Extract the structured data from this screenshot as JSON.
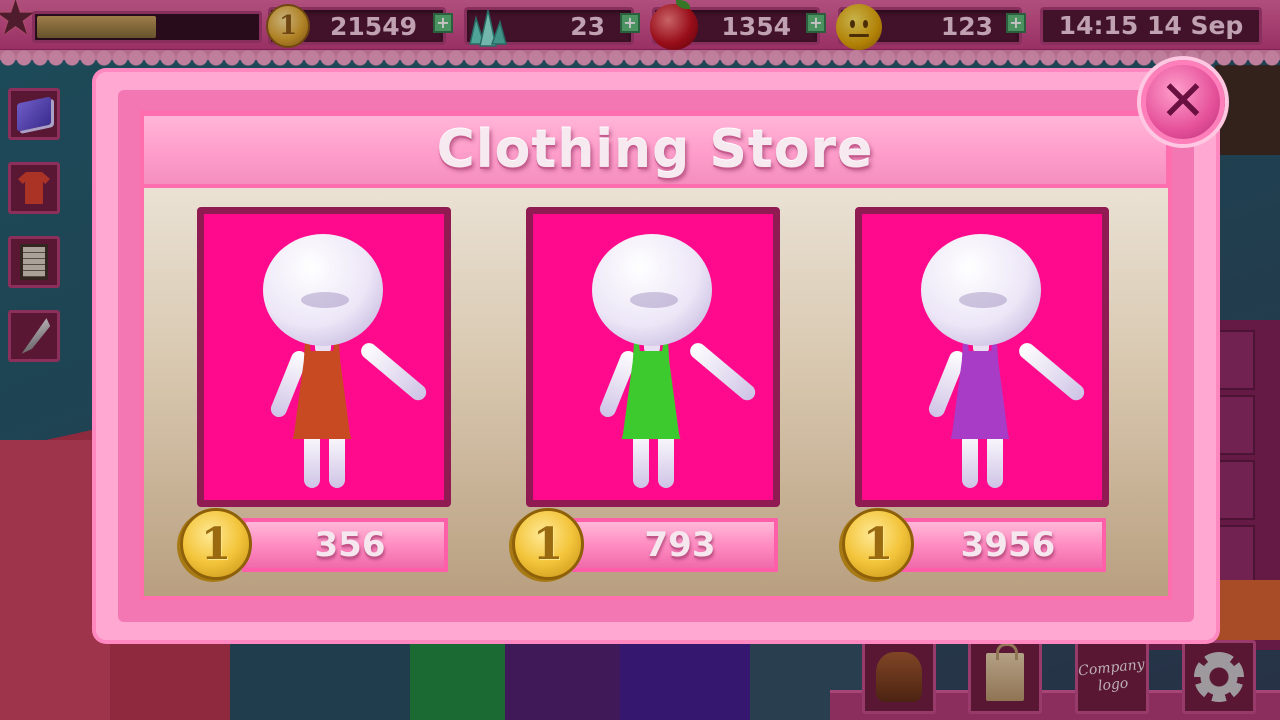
{
  "hud": {
    "xp_fill": 0.55,
    "coins": "21549",
    "gems": "23",
    "food": "1354",
    "happiness": "123",
    "datetime": "14:15 14 Sep",
    "coin_glyph": "1",
    "plus": "+"
  },
  "store": {
    "title": "Clothing Store",
    "close_glyph": "✕",
    "items": [
      {
        "dress_color": "#c74a22",
        "price": "356",
        "coin_glyph": "1"
      },
      {
        "dress_color": "#3dca2f",
        "price": "793",
        "coin_glyph": "1"
      },
      {
        "dress_color": "#a83cc7",
        "price": "3956",
        "coin_glyph": "1"
      }
    ]
  },
  "bottom": {
    "logo_line1": "Company",
    "logo_line2": "logo"
  },
  "icons": {
    "sidebar": [
      "book-icon",
      "shirt-icon",
      "clipboard-icon",
      "saw-icon"
    ],
    "bottom": [
      "backpack-icon",
      "shopping-bag-icon",
      "company-logo",
      "gear-icon"
    ]
  }
}
